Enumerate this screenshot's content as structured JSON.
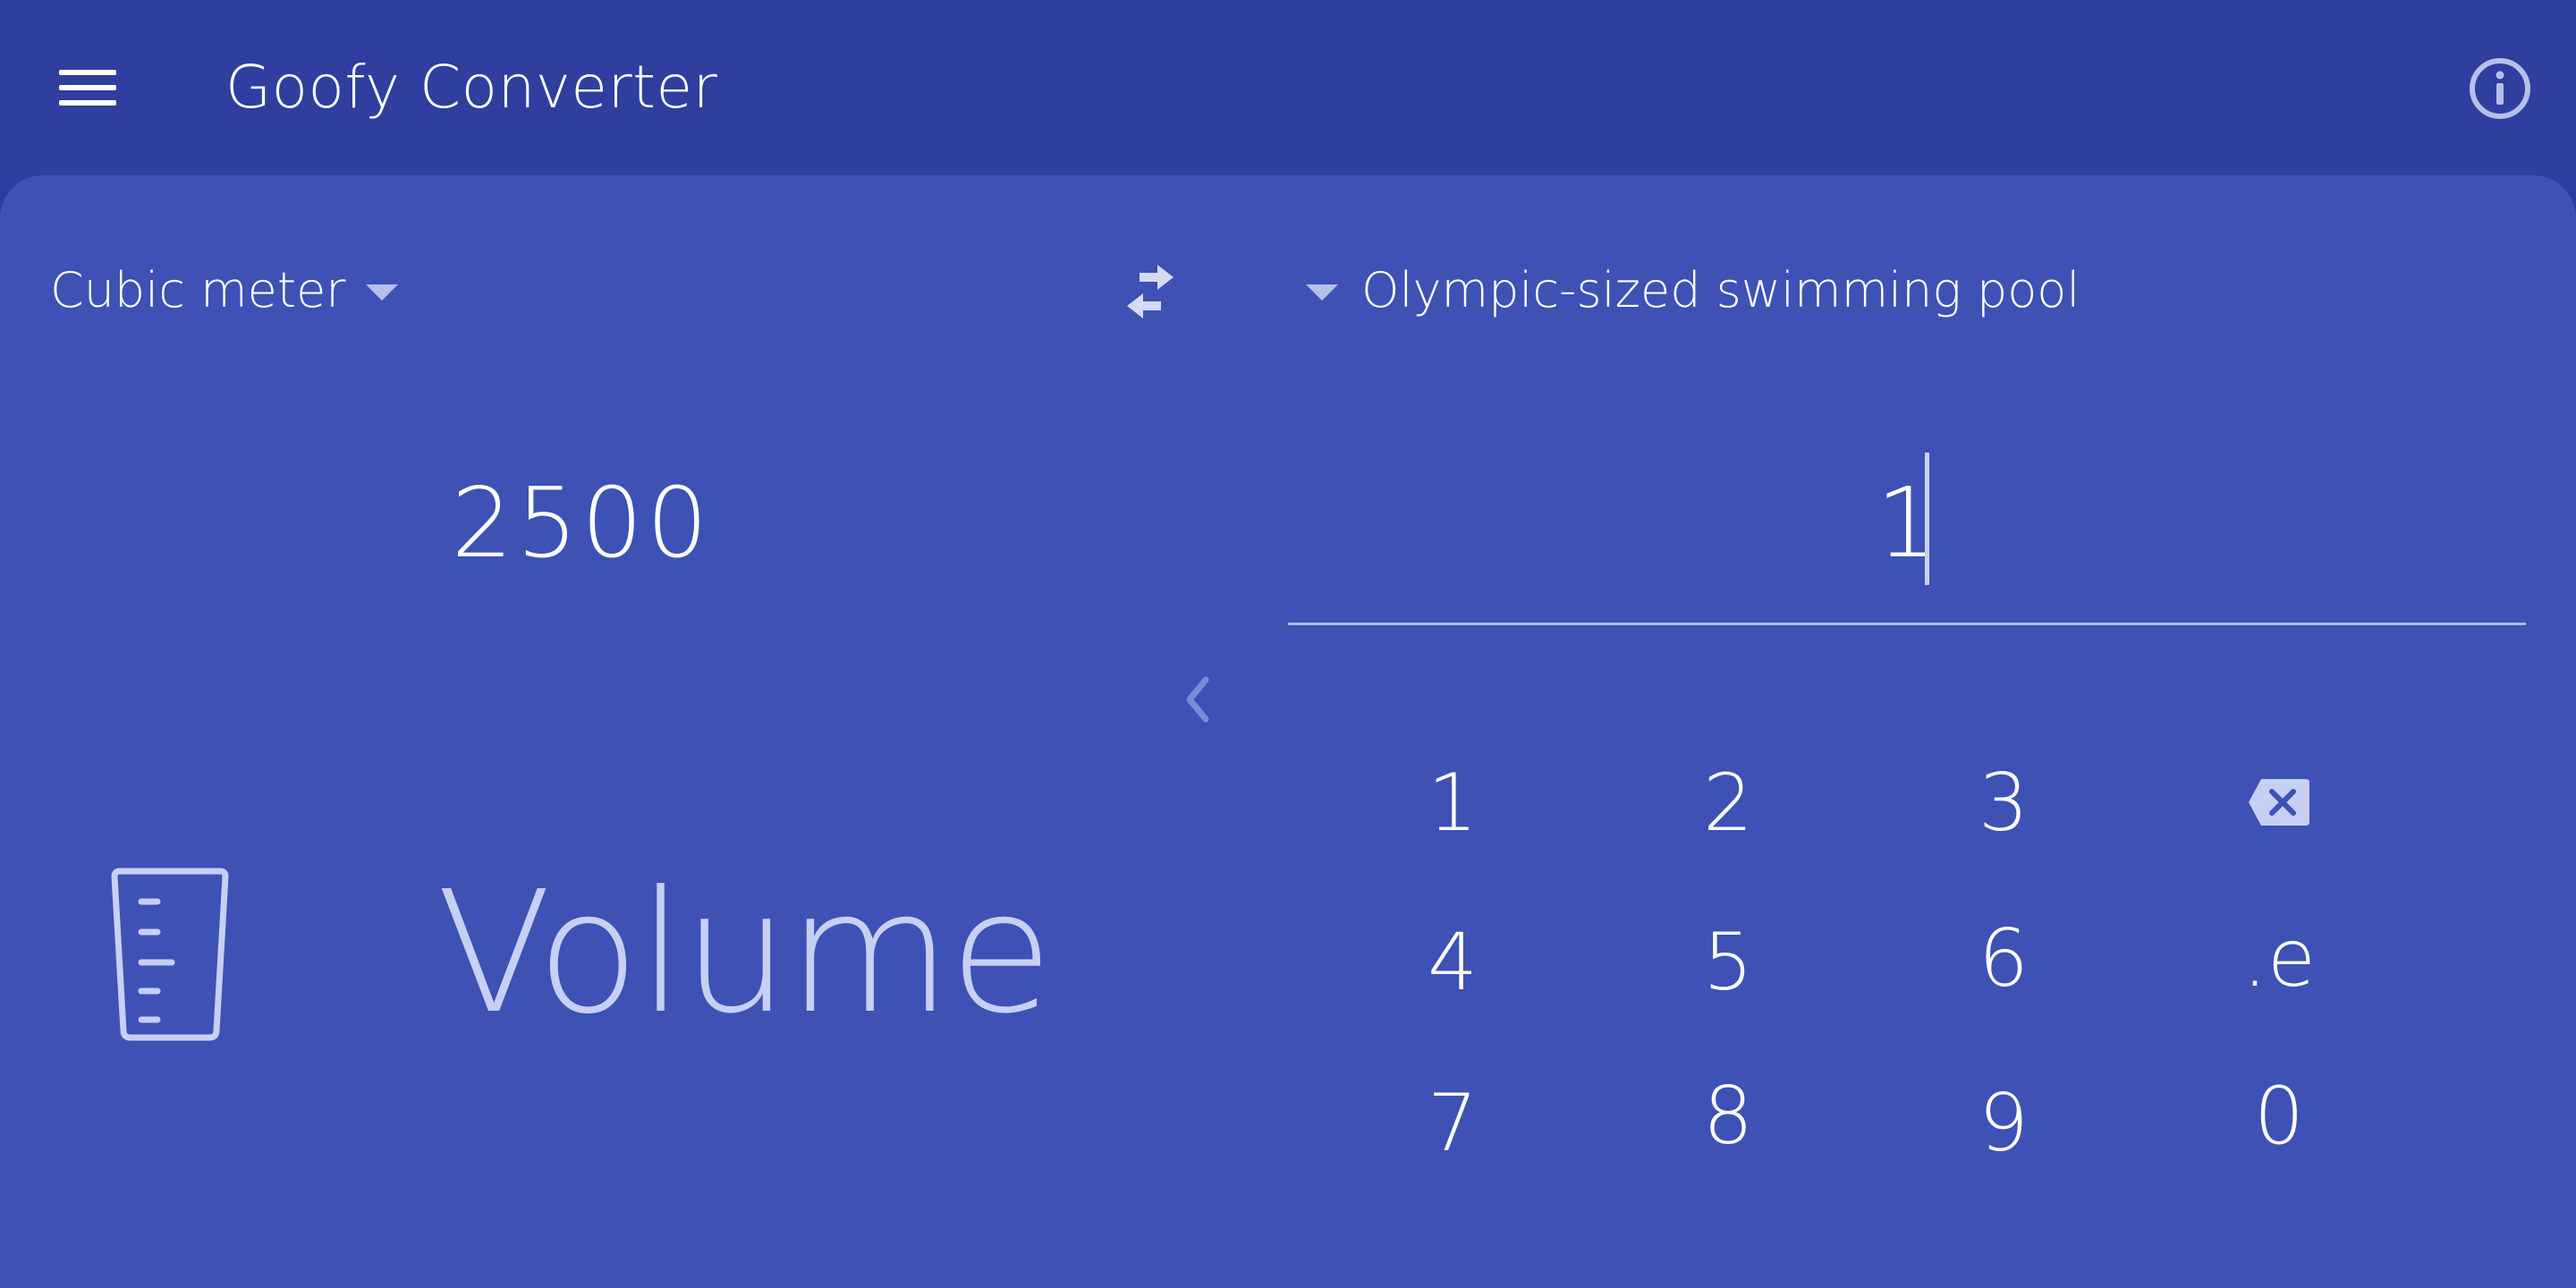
{
  "appbar": {
    "title": "Goofy Converter"
  },
  "converter": {
    "from_unit": "Cubic meter",
    "to_unit": "Olympic-sized swimming pool",
    "from_value": "2500",
    "to_value": "1"
  },
  "category": {
    "label": "Volume",
    "icon": "beaker-icon"
  },
  "keypad": {
    "keys": [
      "1",
      "2",
      "3",
      "4",
      "5",
      "6",
      ".e",
      "7",
      "8",
      "9",
      "0"
    ],
    "backspace_icon": "backspace-icon"
  },
  "colors": {
    "appbar_bg": "#2f3e9f",
    "panel_bg": "#3e51b5",
    "accent_light": "#b7c0ea",
    "text": "#ffffff"
  }
}
